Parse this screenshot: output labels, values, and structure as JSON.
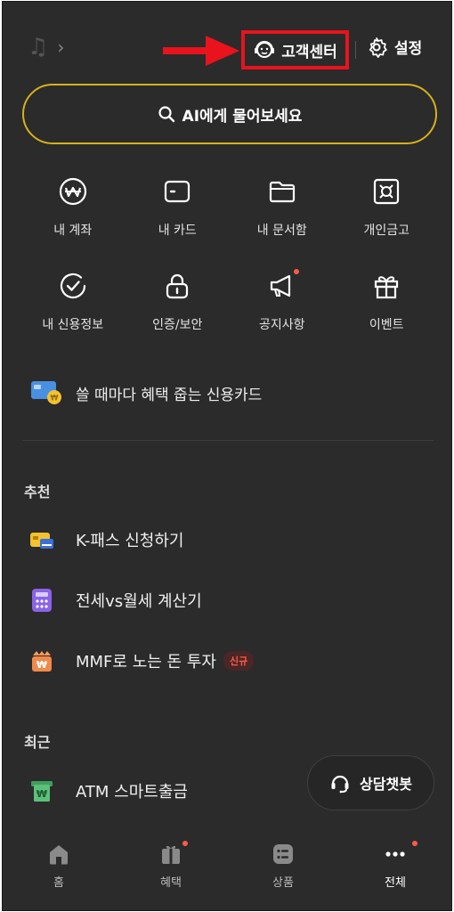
{
  "header": {
    "customer_center_label": "고객센터",
    "settings_label": "설정"
  },
  "ai_search": {
    "label": "AI에게 물어보세요"
  },
  "menu_grid": [
    {
      "label": "내 계좌",
      "icon": "won-circle-icon"
    },
    {
      "label": "내 카드",
      "icon": "card-icon"
    },
    {
      "label": "내 문서함",
      "icon": "folder-icon"
    },
    {
      "label": "개인금고",
      "icon": "safe-icon"
    },
    {
      "label": "내 신용정보",
      "icon": "check-circle-icon"
    },
    {
      "label": "인증/보안",
      "icon": "lock-icon"
    },
    {
      "label": "공지사항",
      "icon": "megaphone-icon",
      "dot": true
    },
    {
      "label": "이벤트",
      "icon": "gift-icon"
    }
  ],
  "promo": {
    "label": "쓸 때마다 혜택 줍는 신용카드"
  },
  "recommend": {
    "title": "추천",
    "items": [
      {
        "label": "K-패스 신청하기",
        "icon": "kpass-card-icon"
      },
      {
        "label": "전세vs월세 계산기",
        "icon": "calculator-icon"
      },
      {
        "label": "MMF로 노는 돈 투자",
        "icon": "money-gift-icon",
        "badge": "신규"
      }
    ]
  },
  "recent": {
    "title": "최근",
    "items": [
      {
        "label": "ATM 스마트출금",
        "icon": "atm-icon"
      }
    ]
  },
  "chatbot": {
    "label": "상담챗봇"
  },
  "bottom_nav": [
    {
      "label": "홈",
      "icon": "home-icon"
    },
    {
      "label": "혜택",
      "icon": "benefit-icon",
      "dot": true
    },
    {
      "label": "상품",
      "icon": "products-icon"
    },
    {
      "label": "전체",
      "icon": "more-icon",
      "dot": true,
      "active": true
    }
  ],
  "colors": {
    "background": "#2b2b2b",
    "accent_yellow": "#d6b11d",
    "highlight_red": "#e8131c",
    "notification_dot": "#ff5a4a"
  }
}
